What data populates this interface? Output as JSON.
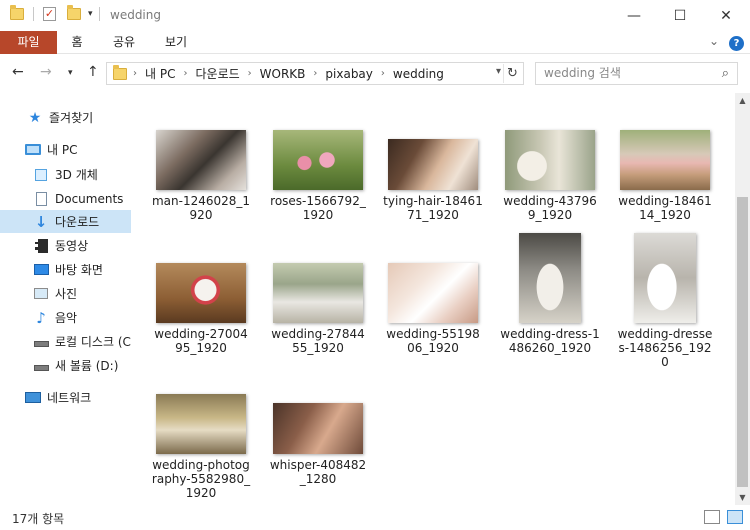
{
  "window": {
    "title": "wedding"
  },
  "ribbon": {
    "tabs": [
      "파일",
      "홈",
      "공유",
      "보기"
    ]
  },
  "address": {
    "crumbs": [
      "내 PC",
      "다운로드",
      "WORKB",
      "pixabay",
      "wedding"
    ]
  },
  "search": {
    "placeholder": "wedding 검색"
  },
  "sidebar": {
    "items": [
      {
        "label": "즐겨찾기"
      },
      {
        "label": "내 PC"
      },
      {
        "label": "3D 개체"
      },
      {
        "label": "Documents"
      },
      {
        "label": "다운로드"
      },
      {
        "label": "동영상"
      },
      {
        "label": "바탕 화면"
      },
      {
        "label": "사진"
      },
      {
        "label": "음악"
      },
      {
        "label": "로컬 디스크 (C"
      },
      {
        "label": "새 볼륨 (D:)"
      },
      {
        "label": "네트워크"
      }
    ]
  },
  "files": [
    {
      "name": "man-1246028_1920"
    },
    {
      "name": "roses-1566792_1920"
    },
    {
      "name": "tying-hair-1846171_1920"
    },
    {
      "name": "wedding-437969_1920"
    },
    {
      "name": "wedding-1846114_1920"
    },
    {
      "name": "wedding-2700495_1920"
    },
    {
      "name": "wedding-2784455_1920"
    },
    {
      "name": "wedding-5519806_1920"
    },
    {
      "name": "wedding-dress-1486260_1920"
    },
    {
      "name": "wedding-dresses-1486256_1920"
    },
    {
      "name": "wedding-photography-5582980_1920"
    },
    {
      "name": "whisper-408482_1280"
    }
  ],
  "status": {
    "count_text": "17개 항목"
  }
}
